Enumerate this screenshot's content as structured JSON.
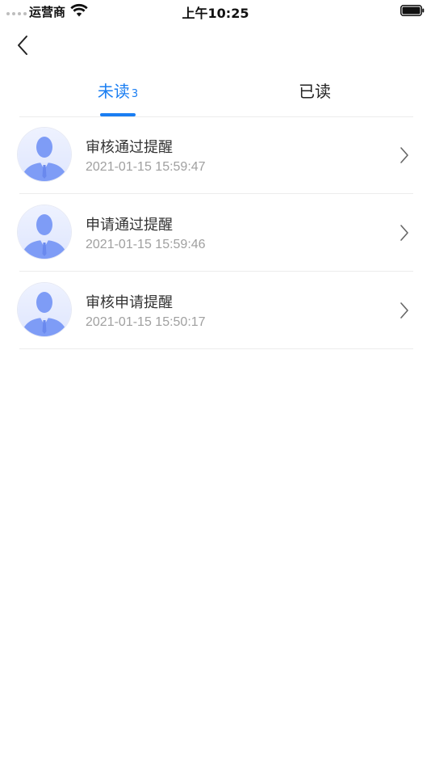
{
  "status_bar": {
    "carrier": "运营商",
    "time": "上午10:25"
  },
  "tabs": [
    {
      "label": "未读",
      "badge": "3"
    },
    {
      "label": "已读"
    }
  ],
  "messages": [
    {
      "title": "审核通过提醒",
      "time": "2021-01-15 15:59:47"
    },
    {
      "title": "申请通过提醒",
      "time": "2021-01-15 15:59:46"
    },
    {
      "title": "审核申请提醒",
      "time": "2021-01-15 15:50:17"
    }
  ],
  "colors": {
    "accent": "#1a7ef2",
    "avatar_figure": "#7e9cf6"
  },
  "icons": {
    "back": "chevron-left-icon",
    "row_arrow": "chevron-right-icon",
    "avatar": "user-avatar-icon"
  }
}
